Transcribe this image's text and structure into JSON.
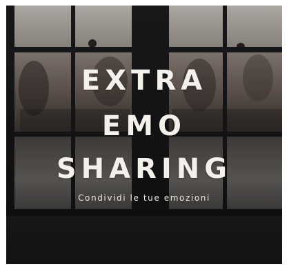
{
  "image": {
    "title_lines": [
      "EXTRA",
      "EMO",
      "SHARING"
    ],
    "subtitle": "Condividi le tue emozioni",
    "colors": {
      "background": "#2a2a2c",
      "window_frame": "#1c1c1e",
      "glass_light": "#bdb7b0",
      "text": "#f4f1ec"
    }
  }
}
